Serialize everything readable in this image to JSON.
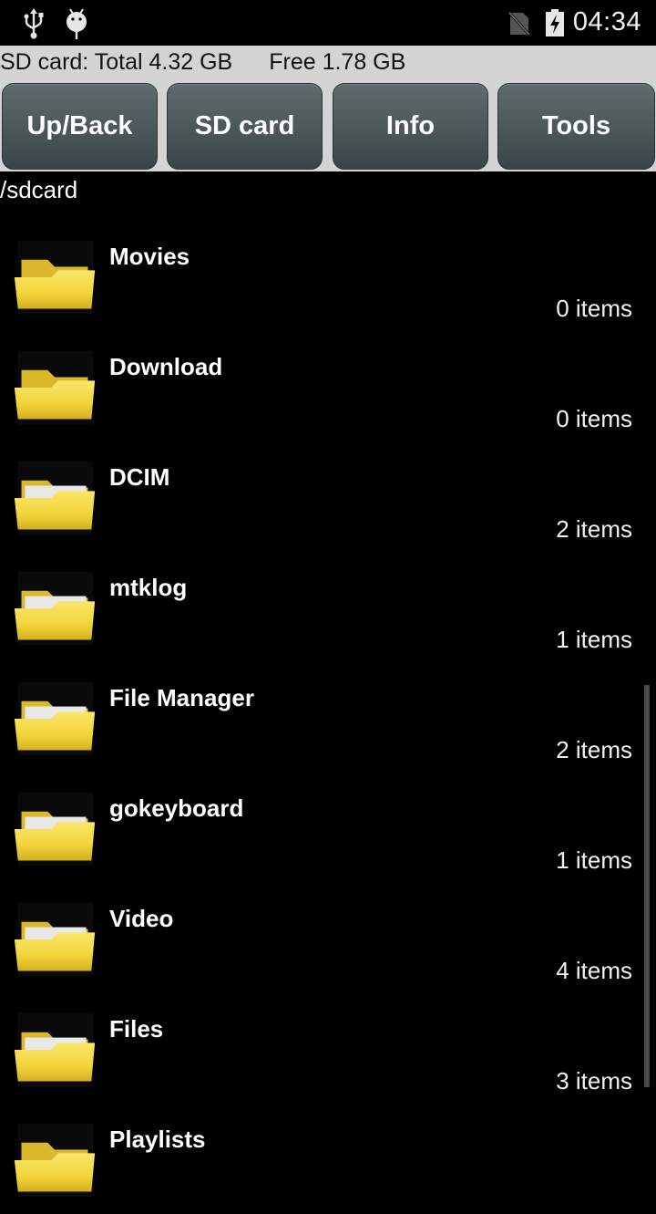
{
  "status_bar": {
    "left_icons": [
      "usb-icon",
      "android-debug-icon"
    ],
    "right_icons": [
      "no-sim-icon",
      "battery-charging-icon"
    ],
    "time": "04:34"
  },
  "storage": {
    "total_label": "SD card: Total 4.32 GB",
    "free_label": "Free 1.78 GB"
  },
  "toolbar": {
    "up_back_label": "Up/Back",
    "sd_card_label": "SD card",
    "info_label": "Info",
    "tools_label": "Tools"
  },
  "current_path": "/sdcard",
  "folders": [
    {
      "name": "Movies",
      "count": "0 items",
      "icon": "folder-empty-icon"
    },
    {
      "name": "Download",
      "count": "0 items",
      "icon": "folder-empty-icon"
    },
    {
      "name": "DCIM",
      "count": "2 items",
      "icon": "folder-with-files-icon"
    },
    {
      "name": "mtklog",
      "count": "1 items",
      "icon": "folder-with-files-icon"
    },
    {
      "name": "File Manager",
      "count": "2 items",
      "icon": "folder-with-files-icon"
    },
    {
      "name": "gokeyboard",
      "count": "1 items",
      "icon": "folder-with-files-icon"
    },
    {
      "name": "Video",
      "count": "4 items",
      "icon": "folder-with-files-icon"
    },
    {
      "name": "Files",
      "count": "3 items",
      "icon": "folder-with-files-icon"
    },
    {
      "name": "Playlists",
      "count": "",
      "icon": "folder-empty-icon"
    }
  ],
  "colors": {
    "folder_yellow": "#f2d43a",
    "button_top": "#5f6c6e",
    "button_bottom": "#3a4547",
    "info_bar_bg": "#d4d4d4"
  }
}
